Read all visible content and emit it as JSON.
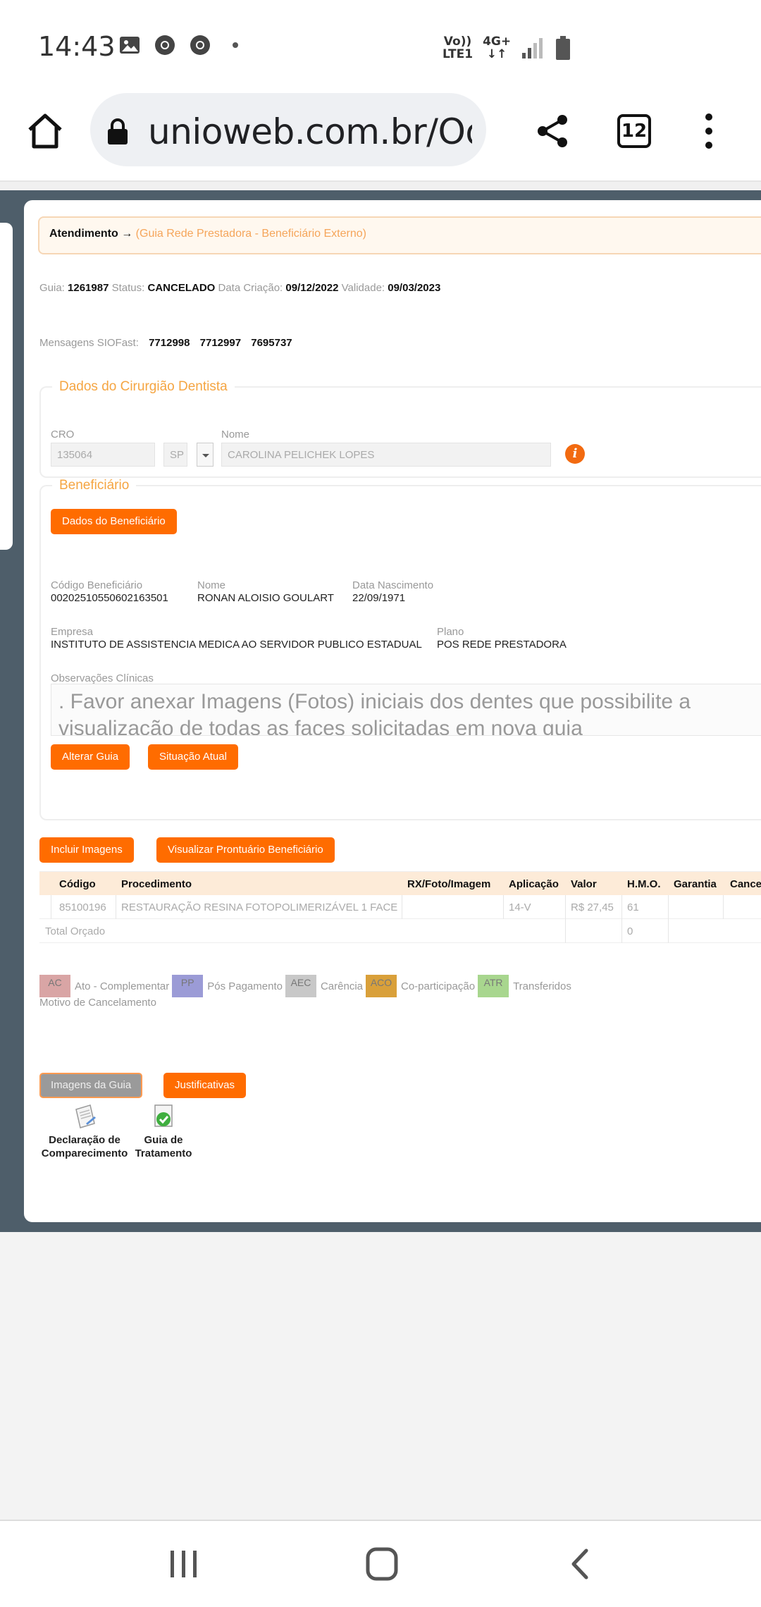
{
  "status_bar": {
    "time": "14:43",
    "net_line1": "Vo))",
    "net_line2": "LTE1",
    "net_gen": "4G+"
  },
  "browser": {
    "url": "unioweb.com.br/Odon",
    "tab_count": "12"
  },
  "breadcrumb": {
    "section": "Atendimento →",
    "subtitle": "(Guia Rede Prestadora - Beneficiário Externo)"
  },
  "guide_info": {
    "guia_label": "Guia:",
    "guia_value": "1261987",
    "status_label": "Status:",
    "status_value": "CANCELADO",
    "created_label": "Data Criação:",
    "created_value": "09/12/2022",
    "validity_label": "Validade:",
    "validity_value": "09/03/2023"
  },
  "messages": {
    "label": "Mensagens SIOFast:",
    "values": [
      "7712998",
      "7712997",
      "7695737"
    ]
  },
  "dentist": {
    "legend": "Dados do Cirurgião Dentista",
    "cro_label": "CRO",
    "cro_value": "135064",
    "uf_value": "SP",
    "name_label": "Nome",
    "name_value": "CAROLINA PELICHEK LOPES",
    "info_glyph": "i"
  },
  "beneficiary": {
    "legend": "Beneficiário",
    "data_button": "Dados do Beneficiário",
    "code_label": "Código Beneficiário",
    "code_value": "00202510550602163501",
    "name_label": "Nome",
    "name_value": "RONAN ALOISIO GOULART",
    "birth_label": "Data Nascimento",
    "birth_value": "22/09/1971",
    "company_label": "Empresa",
    "company_value": "INSTITUTO DE ASSISTENCIA MEDICA AO SERVIDOR PUBLICO ESTADUAL",
    "plan_label": "Plano",
    "plan_value": "POS REDE PRESTADORA",
    "obs_label": "Observações Clínicas",
    "obs_value": ". Favor anexar Imagens (Fotos) iniciais dos dentes que possibilite a visualização de todas as faces solicitadas em nova guia",
    "alter_button": "Alterar Guia",
    "situation_button": "Situação Atual"
  },
  "actions": {
    "include_images": "Incluir Imagens",
    "view_record": "Visualizar Prontuário Beneficiário"
  },
  "table": {
    "headers": {
      "code": "Código",
      "procedure": "Procedimento",
      "rx": "RX/Foto/Imagem",
      "application": "Aplicação",
      "value": "Valor",
      "hmo": "H.M.O.",
      "warranty": "Garantia",
      "cancel": "Cance"
    },
    "row": {
      "code": "85100196",
      "procedure": "RESTAURAÇÃO RESINA FOTOPOLIMERIZÁVEL 1 FACE",
      "rx": "",
      "application": "14-V",
      "value": "R$ 27,45",
      "hmo": "61"
    },
    "total_label": "Total Orçado",
    "total_hmo": "0"
  },
  "legend": [
    {
      "code": "AC",
      "text": "Ato - Complementar",
      "color": "#d9a5a5"
    },
    {
      "code": "PP",
      "text": "Pós Pagamento",
      "color": "#9b9bd6"
    },
    {
      "code": "AEC",
      "text": "Carência",
      "color": "#c8c8c8"
    },
    {
      "code": "ACO",
      "text": "Co-participação",
      "color": "#d9a03a"
    },
    {
      "code": "ATR",
      "text": "Transferidos",
      "color": "#a8d68e"
    }
  ],
  "cancel_reason_label": "Motivo de Cancelamento",
  "bottom_buttons": {
    "images": "Imagens da Guia",
    "justifications": "Justificativas"
  },
  "documents": [
    {
      "line1": "Declaração de",
      "line2": "Comparecimento"
    },
    {
      "line1": "Guia de",
      "line2": "Tratamento"
    }
  ],
  "colors": {
    "accent": "#ff6c00",
    "page_frame": "#4e5e6a"
  }
}
